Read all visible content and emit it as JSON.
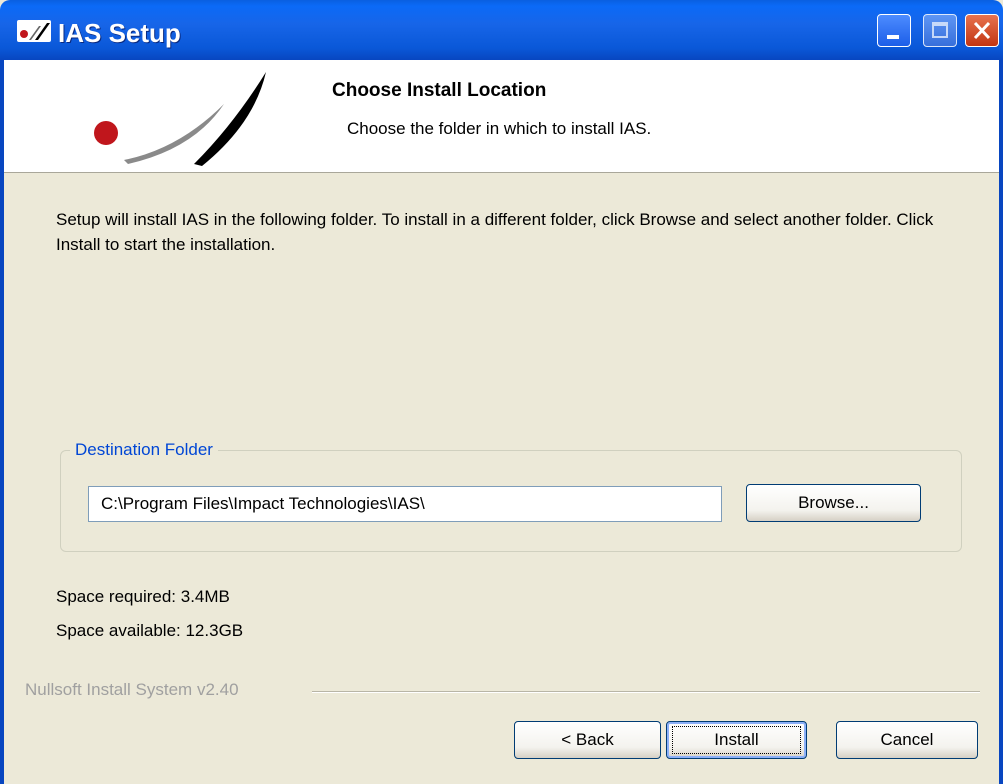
{
  "window": {
    "title": "IAS Setup",
    "icon": "nsis-installer-icon",
    "controls": [
      "minimize-icon",
      "maximize-icon",
      "close-icon"
    ]
  },
  "header": {
    "title": "Choose Install Location",
    "subtitle": "Choose the folder in which to install IAS."
  },
  "intro_text": "Setup will install IAS in the following folder. To install in a different folder, click Browse and select another folder. Click Install to start the installation.",
  "destination": {
    "legend": "Destination Folder",
    "path_value": "C:\\Program Files\\Impact Technologies\\IAS\\",
    "browse_label": "Browse..."
  },
  "space": {
    "required": "Space required: 3.4MB",
    "available": "Space available: 12.3GB"
  },
  "branding": "Nullsoft Install System v2.40",
  "buttons": {
    "back": "< Back",
    "install": "Install",
    "cancel": "Cancel"
  },
  "colors": {
    "titlebar": "#0a58d8",
    "dialog_bg": "#ece9d8",
    "legend_text": "#0046d5",
    "logo_dot": "#c0161c"
  }
}
